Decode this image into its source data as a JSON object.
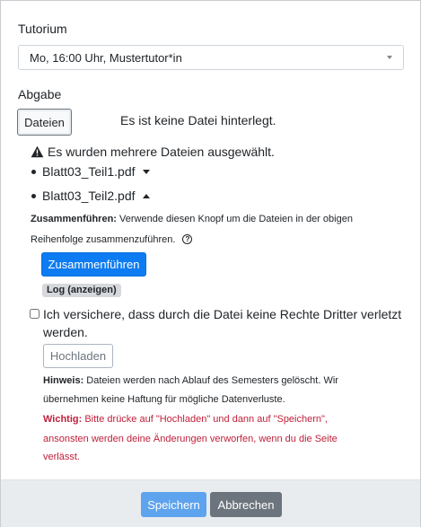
{
  "tutorium": {
    "label": "Tutorium",
    "selected": "Mo, 16:00 Uhr, Mustertutor*in"
  },
  "abgabe": {
    "label": "Abgabe",
    "files_button": "Dateien",
    "no_file_text": "Es ist keine Datei hinterlegt.",
    "warning_text": "Es wurden mehrere Dateien ausgewählt.",
    "files": [
      {
        "name": "Blatt03_Teil1.pdf"
      },
      {
        "name": "Blatt03_Teil2.pdf"
      }
    ],
    "merge_hint_bold": "Zusammenführen:",
    "merge_hint_line1": "Verwende diesen Knopf um die Dateien in der obigen",
    "merge_hint_line2": "Reihenfolge zusammenzuführen.",
    "merge_button": "Zusammenführen",
    "log_badge": "Log (anzeigen)",
    "consent_label": "Ich versichere, dass durch die Datei keine Rechte Dritter verletzt werden.",
    "upload_button": "Hochladen",
    "note_bold": "Hinweis:",
    "note_line1": "Dateien werden nach Ablauf des Semesters gelöscht. Wir",
    "note_line2": "übernehmen keine Haftung für mögliche Datenverluste.",
    "important_bold": "Wichtig:",
    "important_line1": "Bitte drücke auf \"Hochladen\" und dann auf \"Speichern\",",
    "important_line2": "ansonsten werden deine Änderungen verworfen, wenn du die Seite",
    "important_line3": "verlässt."
  },
  "footer": {
    "save_button": "Speichern",
    "cancel_button": "Abbrechen"
  },
  "colors": {
    "primary": "#0d7cf2",
    "primary_disabled": "#5ea3ee",
    "secondary": "#6c757d",
    "danger": "#c0203a"
  }
}
